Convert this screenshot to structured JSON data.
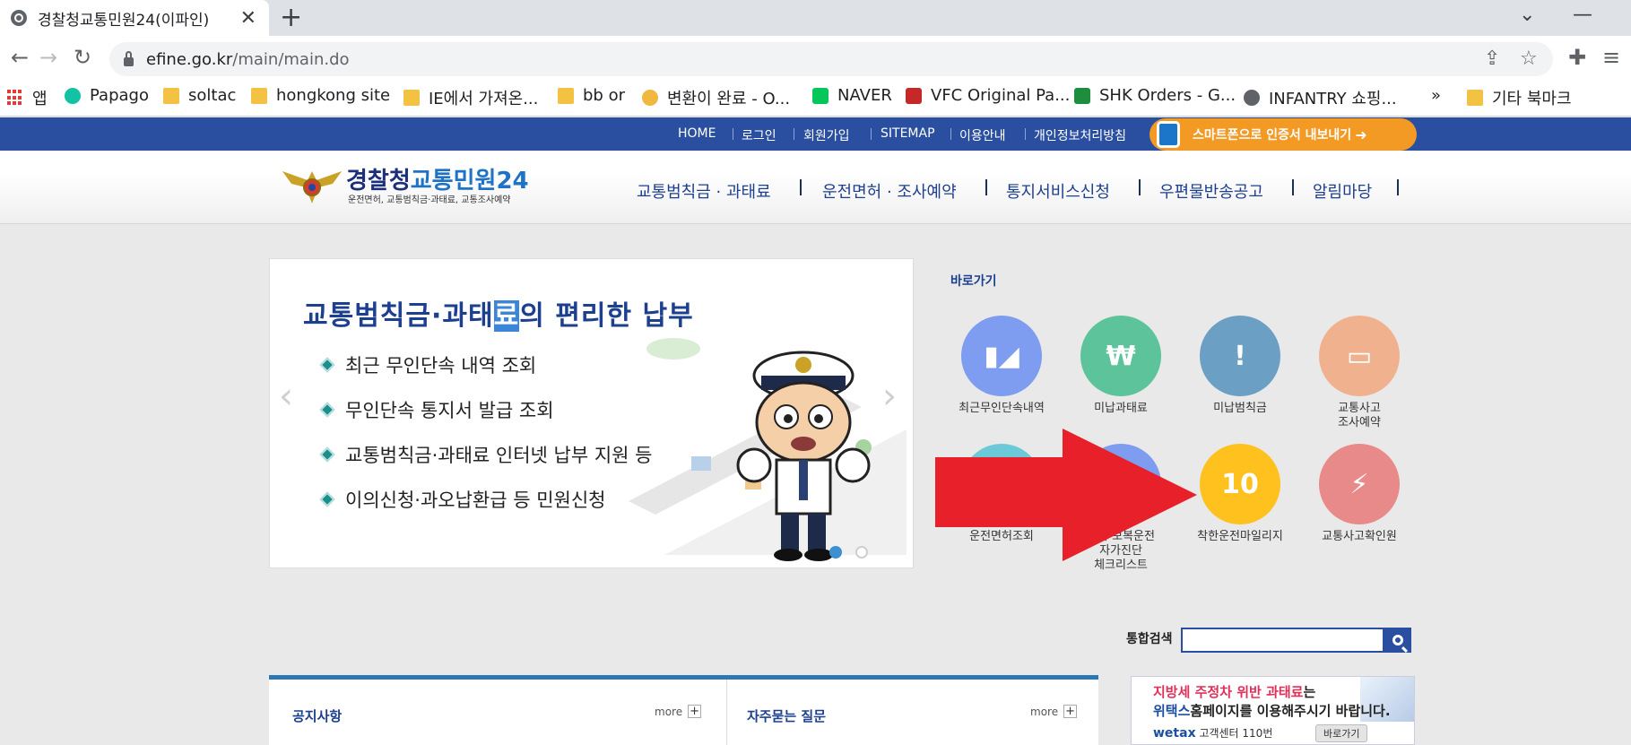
{
  "browser": {
    "tab_title": "경찰청교통민원24(이파인)",
    "url_host": "efine.go.kr",
    "url_path": "/main/main.do",
    "bookmarks": [
      {
        "label": "앱",
        "icon": "apps-icon"
      },
      {
        "label": "Papago",
        "icon": "papago-icon"
      },
      {
        "label": "soltac",
        "icon": "folder-icon"
      },
      {
        "label": "hongkong site",
        "icon": "folder-icon"
      },
      {
        "label": "IE에서 가져온...",
        "icon": "folder-icon"
      },
      {
        "label": "bb or",
        "icon": "folder-icon"
      },
      {
        "label": "변환이 완료 - O...",
        "icon": "converter-icon"
      },
      {
        "label": "NAVER",
        "icon": "naver-icon"
      },
      {
        "label": "VFC Original Pa...",
        "icon": "mle-icon"
      },
      {
        "label": "SHK Orders - G...",
        "icon": "sheets-icon"
      },
      {
        "label": "INFANTRY 쇼핑...",
        "icon": "globe-icon"
      },
      {
        "label": "»",
        "icon": "overflow-icon"
      },
      {
        "label": "기타 북마크",
        "icon": "folder-icon"
      }
    ]
  },
  "site": {
    "top_links": [
      "HOME",
      "로그인",
      "회원가입",
      "SITEMAP",
      "이용안내",
      "개인정보처리방침"
    ],
    "smart_button": "스마트폰으로 인증서 내보내기",
    "logo_main_a": "경찰청",
    "logo_main_b": "교통민원24",
    "logo_sub": "운전면허, 교통범칙금·과태료, 교통조사예약",
    "gnb": [
      "교통범칙금 · 과태료",
      "운전면허 · 조사예약",
      "통지서비스신청",
      "우편물반송공고",
      "알림마당"
    ]
  },
  "banner": {
    "title_a": "교통범칙금·과태",
    "title_hl": "료",
    "title_b": "의 편리한 납부",
    "items": [
      "최근 무인단속 내역 조회",
      "무인단속 통지서 발급 조회",
      "교통범칙금·과태료 인터넷 납부 지원 등",
      "이의신청·과오납환급 등 민원신청"
    ]
  },
  "quick": {
    "title": "바로가기",
    "items": [
      {
        "label": "최근무인단속내역",
        "color": "#7e9cf0",
        "icon": "camera-icon"
      },
      {
        "label": "미납과태료",
        "color": "#5cc39a",
        "icon": "money-icon"
      },
      {
        "label": "미납범칙금",
        "color": "#6b9fc4",
        "icon": "warning-icon"
      },
      {
        "label": "교통사고\n조사예약",
        "color": "#f0b28e",
        "icon": "computer-icon"
      },
      {
        "label": "운전면허조회",
        "color": "#6cc9d8",
        "icon": "license-icon"
      },
      {
        "label": "난폭·보복운전\n자가진단\n체크리스트",
        "color": "#7e9cf0",
        "icon": "checklist-icon"
      },
      {
        "label": "착한운전마일리지",
        "color": "#ffc11e",
        "icon": "mileage-icon"
      },
      {
        "label": "교통사고확인원",
        "color": "#e88a8a",
        "icon": "accident-icon"
      }
    ]
  },
  "search": {
    "label": "통합검색",
    "value": ""
  },
  "boards": {
    "notice_title": "공지사항",
    "faq_title": "자주묻는 질문",
    "more": "more"
  },
  "wetax": {
    "line1_red": "지방세 주정차 위반 과태료",
    "line1_rest": "는",
    "line2_blue": "위택스",
    "line2_rest": "홈페이지를 이용해주시기 바랍니다.",
    "brand": "wetax",
    "center": "고객센터 110번",
    "go": "바로가기"
  }
}
